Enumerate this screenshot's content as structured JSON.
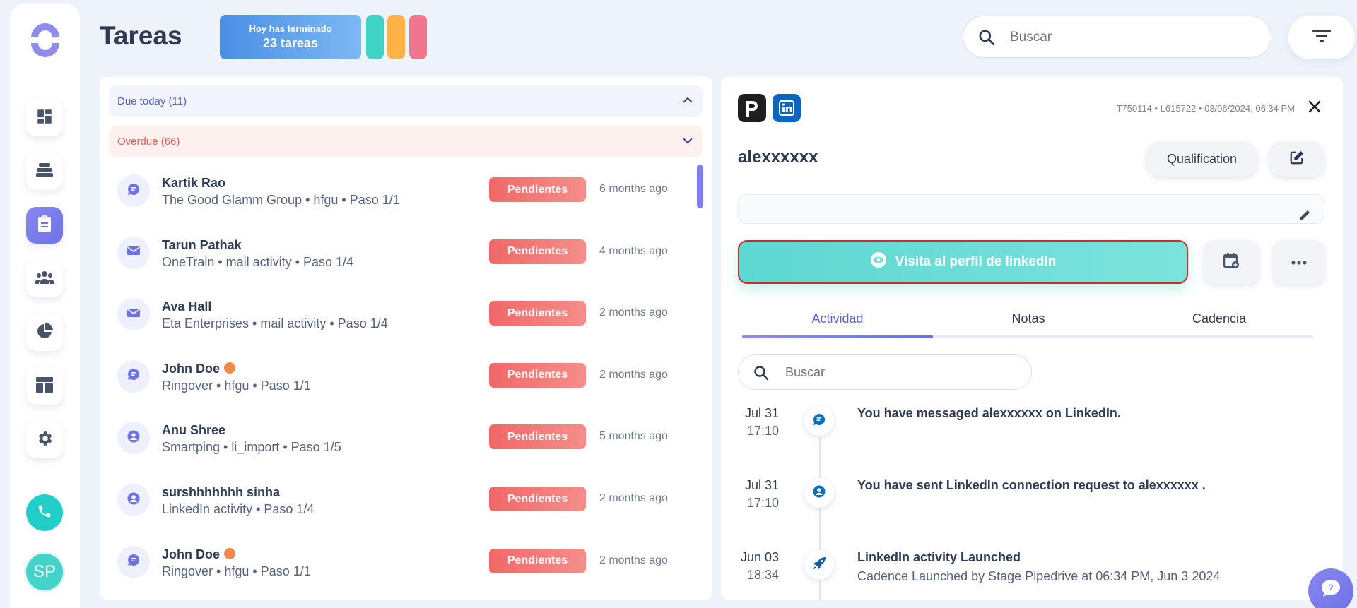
{
  "header": {
    "title": "Tareas",
    "done_line1": "Hoy has terminado",
    "done_line2": "23 tareas",
    "search_placeholder": "Buscar",
    "pill_colors": [
      "#3fd3c6",
      "#ffb347",
      "#f0758f"
    ]
  },
  "sidebar": {
    "items": [
      {
        "icon": "dashboard-icon"
      },
      {
        "icon": "layers-icon"
      },
      {
        "icon": "clipboard-icon",
        "active": true
      },
      {
        "icon": "people-icon"
      },
      {
        "icon": "pie-chart-icon"
      },
      {
        "icon": "layout-icon"
      },
      {
        "icon": "gear-icon"
      }
    ],
    "avatar_initials": "SP"
  },
  "task_groups": {
    "due": "Due today (11)",
    "overdue": "Overdue (66)"
  },
  "tasks": [
    {
      "name": "Kartik Rao",
      "sub": "The Good Glamm Group • hfgu • Paso 1/1",
      "icon": "chat-icon",
      "status": "Pendientes",
      "ago": "6 months ago"
    },
    {
      "name": "Tarun Pathak",
      "sub": "OneTrain • mail activity • Paso 1/4",
      "icon": "mail-icon",
      "status": "Pendientes",
      "ago": "4 months ago"
    },
    {
      "name": "Ava Hall",
      "sub": "Eta Enterprises • mail activity • Paso 1/4",
      "icon": "mail-icon",
      "status": "Pendientes",
      "ago": "2 months ago"
    },
    {
      "name": "John Doe",
      "sub": "Ringover • hfgu • Paso 1/1",
      "icon": "chat-icon",
      "status": "Pendientes",
      "ago": "2 months ago",
      "emoji": true
    },
    {
      "name": "Anu Shree",
      "sub": "Smartping • li_import • Paso 1/5",
      "icon": "user-icon",
      "status": "Pendientes",
      "ago": "5 months ago"
    },
    {
      "name": "surshhhhhhh sinha",
      "sub": "LinkedIn activity • Paso 1/4",
      "icon": "user-icon",
      "status": "Pendientes",
      "ago": "2 months ago"
    },
    {
      "name": "John Doe",
      "sub": "Ringover • hfgu • Paso 1/1",
      "icon": "chat-icon",
      "status": "Pendientes",
      "ago": "2 months ago",
      "emoji": true
    }
  ],
  "detail": {
    "app_icons": [
      "pipedrive-icon",
      "linkedin-icon"
    ],
    "meta": "T750114 • L615722 • 03/06/2024, 06:34 PM",
    "contact_name": "alexxxxxx",
    "qualification_label": "Qualification",
    "visit_label": "Visita al perfil de linkedIn",
    "tabs": [
      "Actividad",
      "Notas",
      "Cadencia"
    ],
    "search_placeholder": "Buscar",
    "events": [
      {
        "date": "Jul 31",
        "time": "17:10",
        "icon": "chat-icon",
        "title": "You have messaged alexxxxxx on LinkedIn.",
        "sub": ""
      },
      {
        "date": "Jul 31",
        "time": "17:10",
        "icon": "user-icon",
        "title": "You have sent LinkedIn connection request to alexxxxxx .",
        "sub": ""
      },
      {
        "date": "Jun 03",
        "time": "18:34",
        "icon": "rocket-icon",
        "title": "LinkedIn activity Launched",
        "sub": "Cadence Launched by Stage Pipedrive at 06:34 PM, Jun 3 2024"
      }
    ]
  }
}
